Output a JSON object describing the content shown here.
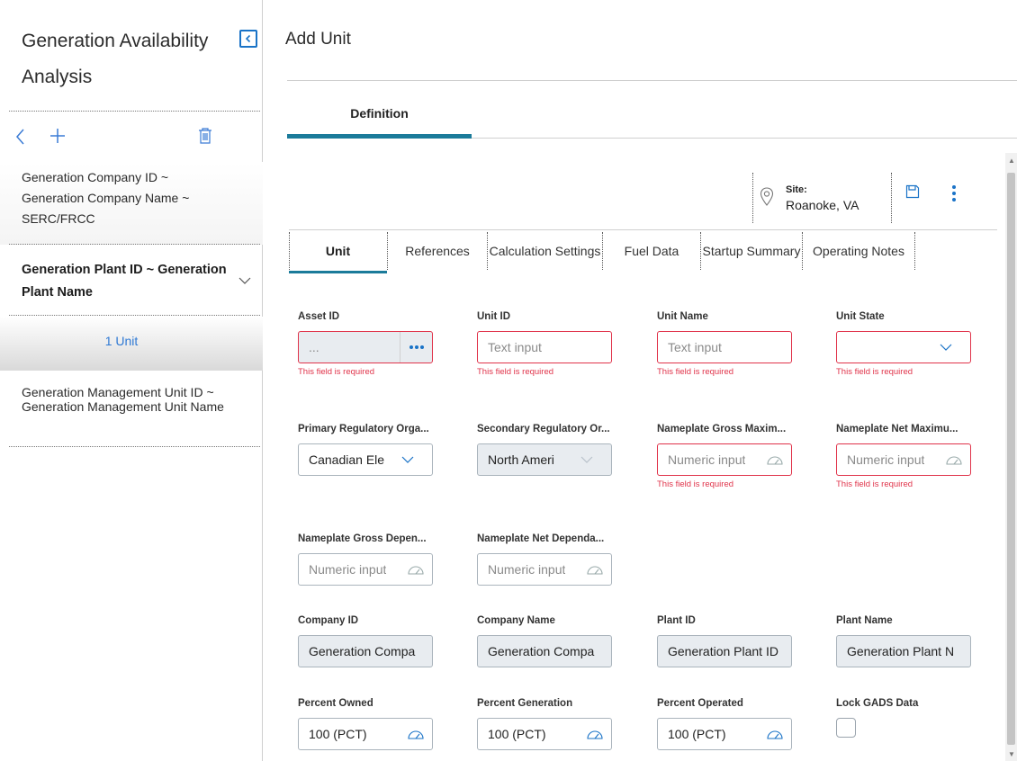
{
  "sidebar": {
    "title": "Generation Availability Analysis",
    "company_item": "Generation Company ID ~ Generation Company Name ~ SERC/FRCC",
    "plant_item": "Generation Plant ID ~ Generation Plant Name",
    "selected_item": "1 Unit",
    "mgmt_item": "Generation Management Unit ID ~ Generation Management Unit Name"
  },
  "main": {
    "title": "Add Unit",
    "definition_tab": "Definition",
    "site_label": "Site:",
    "site_value": "Roanoke, VA",
    "tabs": [
      "Unit",
      "References",
      "Calculation Settings",
      "Fuel Data",
      "Startup Summary",
      "Operating Notes"
    ]
  },
  "required_msg": "This field is required",
  "fields": {
    "asset_id": {
      "label": "Asset ID",
      "value": "..."
    },
    "unit_id": {
      "label": "Unit ID",
      "placeholder": "Text input"
    },
    "unit_name": {
      "label": "Unit Name",
      "placeholder": "Text input"
    },
    "unit_state": {
      "label": "Unit State",
      "value": ""
    },
    "primary_reg": {
      "label": "Primary Regulatory Orga...",
      "value": "Canadian Ele"
    },
    "secondary_reg": {
      "label": "Secondary Regulatory Or...",
      "value": "North Ameri"
    },
    "np_gross_max": {
      "label": "Nameplate Gross Maxim...",
      "placeholder": "Numeric input"
    },
    "np_net_max": {
      "label": "Nameplate Net Maximu...",
      "placeholder": "Numeric input"
    },
    "np_gross_dep": {
      "label": "Nameplate Gross Depen...",
      "placeholder": "Numeric input"
    },
    "np_net_dep": {
      "label": "Nameplate Net Dependa...",
      "placeholder": "Numeric input"
    },
    "company_id": {
      "label": "Company ID",
      "value": "Generation Compa"
    },
    "company_name": {
      "label": "Company Name",
      "value": "Generation Compa"
    },
    "plant_id": {
      "label": "Plant ID",
      "value": "Generation Plant ID"
    },
    "plant_name": {
      "label": "Plant Name",
      "value": "Generation Plant N"
    },
    "pct_owned": {
      "label": "Percent Owned",
      "value": "100 (PCT)"
    },
    "pct_generation": {
      "label": "Percent Generation",
      "value": "100 (PCT)"
    },
    "pct_operated": {
      "label": "Percent Operated",
      "value": "100 (PCT)"
    },
    "lock_gads": {
      "label": "Lock GADS Data",
      "checked": false
    }
  },
  "colors": {
    "accent": "#1b7b9a",
    "link": "#2f79d4",
    "error": "#e0334a",
    "readonly": "#e8ecf0"
  }
}
